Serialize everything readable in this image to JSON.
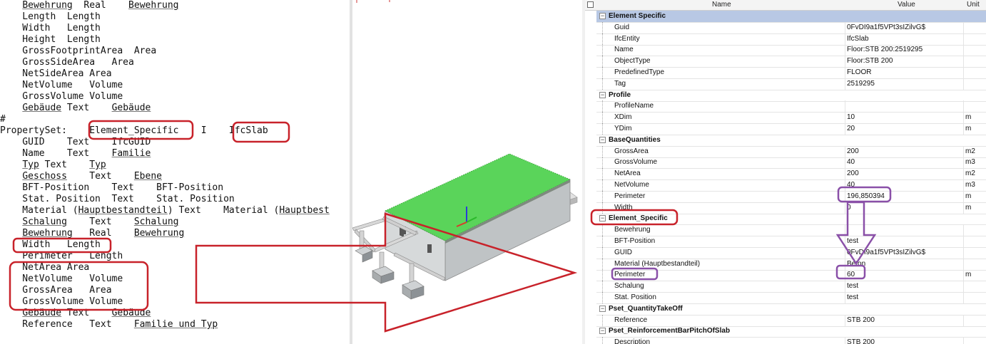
{
  "editor": {
    "lines": [
      [
        {
          "t": "    "
        },
        {
          "t": "Bewehrung",
          "u": true
        },
        {
          "t": "  Real    "
        },
        {
          "t": "Bewehrung",
          "u": true
        }
      ],
      [
        {
          "t": "    Length  Length"
        }
      ],
      [
        {
          "t": "    Width   Length"
        }
      ],
      [
        {
          "t": "    Height  Length"
        }
      ],
      [
        {
          "t": "    GrossFootprintArea  Area"
        }
      ],
      [
        {
          "t": "    GrossSideArea   Area"
        }
      ],
      [
        {
          "t": "    NetSideArea Area"
        }
      ],
      [
        {
          "t": "    NetVolume   Volume"
        }
      ],
      [
        {
          "t": "    GrossVolume Volume"
        }
      ],
      [
        {
          "t": "    "
        },
        {
          "t": "Gebäude",
          "u": true
        },
        {
          "t": " Text    "
        },
        {
          "t": "Gebäude",
          "u": true
        }
      ],
      [
        {
          "t": "#"
        }
      ],
      [
        {
          "t": "PropertySet:    Element_Specific    I    IfcSlab"
        }
      ],
      [
        {
          "t": "    GUID    Text    IfcGUID"
        }
      ],
      [
        {
          "t": "    Name    Text    "
        },
        {
          "t": "Familie",
          "u": true
        }
      ],
      [
        {
          "t": "    "
        },
        {
          "t": "Typ",
          "u": true
        },
        {
          "t": " Text    "
        },
        {
          "t": "Typ",
          "u": true
        }
      ],
      [
        {
          "t": "    "
        },
        {
          "t": "Geschoss",
          "u": true
        },
        {
          "t": "    Text    "
        },
        {
          "t": "Ebene",
          "u": true
        }
      ],
      [
        {
          "t": "    BFT-Position    Text    BFT-Position"
        }
      ],
      [
        {
          "t": "    Stat. Position  Text    Stat. Position"
        }
      ],
      [
        {
          "t": "    Material ("
        },
        {
          "t": "Hauptbestandteil",
          "u": true
        },
        {
          "t": ") Text    Material ("
        },
        {
          "t": "Hauptbest",
          "u": true
        }
      ],
      [
        {
          "t": "    "
        },
        {
          "t": "Schalung",
          "u": true
        },
        {
          "t": "    Text    "
        },
        {
          "t": "Schalung",
          "u": true
        }
      ],
      [
        {
          "t": "    "
        },
        {
          "t": "Bewehrung",
          "u": true
        },
        {
          "t": "   Real    "
        },
        {
          "t": "Bewehrung",
          "u": true
        }
      ],
      [
        {
          "t": "    Width   Length"
        }
      ],
      [
        {
          "t": "    Perimeter   Length"
        }
      ],
      [
        {
          "t": "    NetArea Area"
        }
      ],
      [
        {
          "t": "    NetVolume   Volume"
        }
      ],
      [
        {
          "t": "    GrossArea   Area"
        }
      ],
      [
        {
          "t": "    GrossVolume Volume"
        }
      ],
      [
        {
          "t": "    "
        },
        {
          "t": "Gebäude",
          "u": true
        },
        {
          "t": " Text    "
        },
        {
          "t": "Gebäude",
          "u": true
        }
      ],
      [
        {
          "t": "    Reference   Text    "
        },
        {
          "t": "Familie und Typ",
          "u": true
        }
      ]
    ]
  },
  "properties": {
    "headers": {
      "name": "Name",
      "value": "Value",
      "unit": "Unit"
    },
    "rows": [
      {
        "kind": "group",
        "name": "Element Specific",
        "selected": true
      },
      {
        "kind": "prop",
        "name": "Guid",
        "value": "0FvDI9a1f5VPt3sIZilvG$",
        "unit": ""
      },
      {
        "kind": "prop",
        "name": "IfcEntity",
        "value": "IfcSlab",
        "unit": ""
      },
      {
        "kind": "prop",
        "name": "Name",
        "value": "Floor:STB 200:2519295",
        "unit": ""
      },
      {
        "kind": "prop",
        "name": "ObjectType",
        "value": "Floor:STB 200",
        "unit": ""
      },
      {
        "kind": "prop",
        "name": "PredefinedType",
        "value": "FLOOR",
        "unit": ""
      },
      {
        "kind": "prop",
        "name": "Tag",
        "value": "2519295",
        "unit": ""
      },
      {
        "kind": "group",
        "name": "Profile"
      },
      {
        "kind": "prop",
        "name": "ProfileName",
        "value": "",
        "unit": ""
      },
      {
        "kind": "prop",
        "name": "XDim",
        "value": "10",
        "unit": "m"
      },
      {
        "kind": "prop",
        "name": "YDim",
        "value": "20",
        "unit": "m"
      },
      {
        "kind": "group",
        "name": "BaseQuantities"
      },
      {
        "kind": "prop",
        "name": "GrossArea",
        "value": "200",
        "unit": "m2"
      },
      {
        "kind": "prop",
        "name": "GrossVolume",
        "value": "40",
        "unit": "m3"
      },
      {
        "kind": "prop",
        "name": "NetArea",
        "value": "200",
        "unit": "m2"
      },
      {
        "kind": "prop",
        "name": "NetVolume",
        "value": "40",
        "unit": "m3"
      },
      {
        "kind": "prop",
        "name": "Perimeter",
        "value": "196,850394",
        "unit": "m"
      },
      {
        "kind": "prop",
        "name": "Width",
        "value": "0",
        "unit": "m"
      },
      {
        "kind": "group",
        "name": "Element_Specific"
      },
      {
        "kind": "prop",
        "name": "Bewehrung",
        "value": "",
        "unit": ""
      },
      {
        "kind": "prop",
        "name": "BFT-Position",
        "value": "test",
        "unit": ""
      },
      {
        "kind": "prop",
        "name": "GUID",
        "value": "0FvDI9a1f5VPt3sIZilvG$",
        "unit": ""
      },
      {
        "kind": "prop",
        "name": "Material (Hauptbestandteil)",
        "value": "Beton",
        "unit": ""
      },
      {
        "kind": "prop",
        "name": "Perimeter",
        "value": "60",
        "unit": "m"
      },
      {
        "kind": "prop",
        "name": "Schalung",
        "value": "test",
        "unit": ""
      },
      {
        "kind": "prop",
        "name": "Stat. Position",
        "value": "test",
        "unit": ""
      },
      {
        "kind": "group",
        "name": "Pset_QuantityTakeOff"
      },
      {
        "kind": "prop",
        "name": "Reference",
        "value": "STB 200",
        "unit": ""
      },
      {
        "kind": "group",
        "name": "Pset_ReinforcementBarPitchOfSlab"
      },
      {
        "kind": "prop",
        "name": "Description",
        "value": "STB 200",
        "unit": ""
      }
    ]
  },
  "colors": {
    "annotation_red": "#c8222a",
    "annotation_purple": "#8a50a8",
    "selected_group": "#b8c8e4",
    "slab_top": "#5ad45a"
  }
}
